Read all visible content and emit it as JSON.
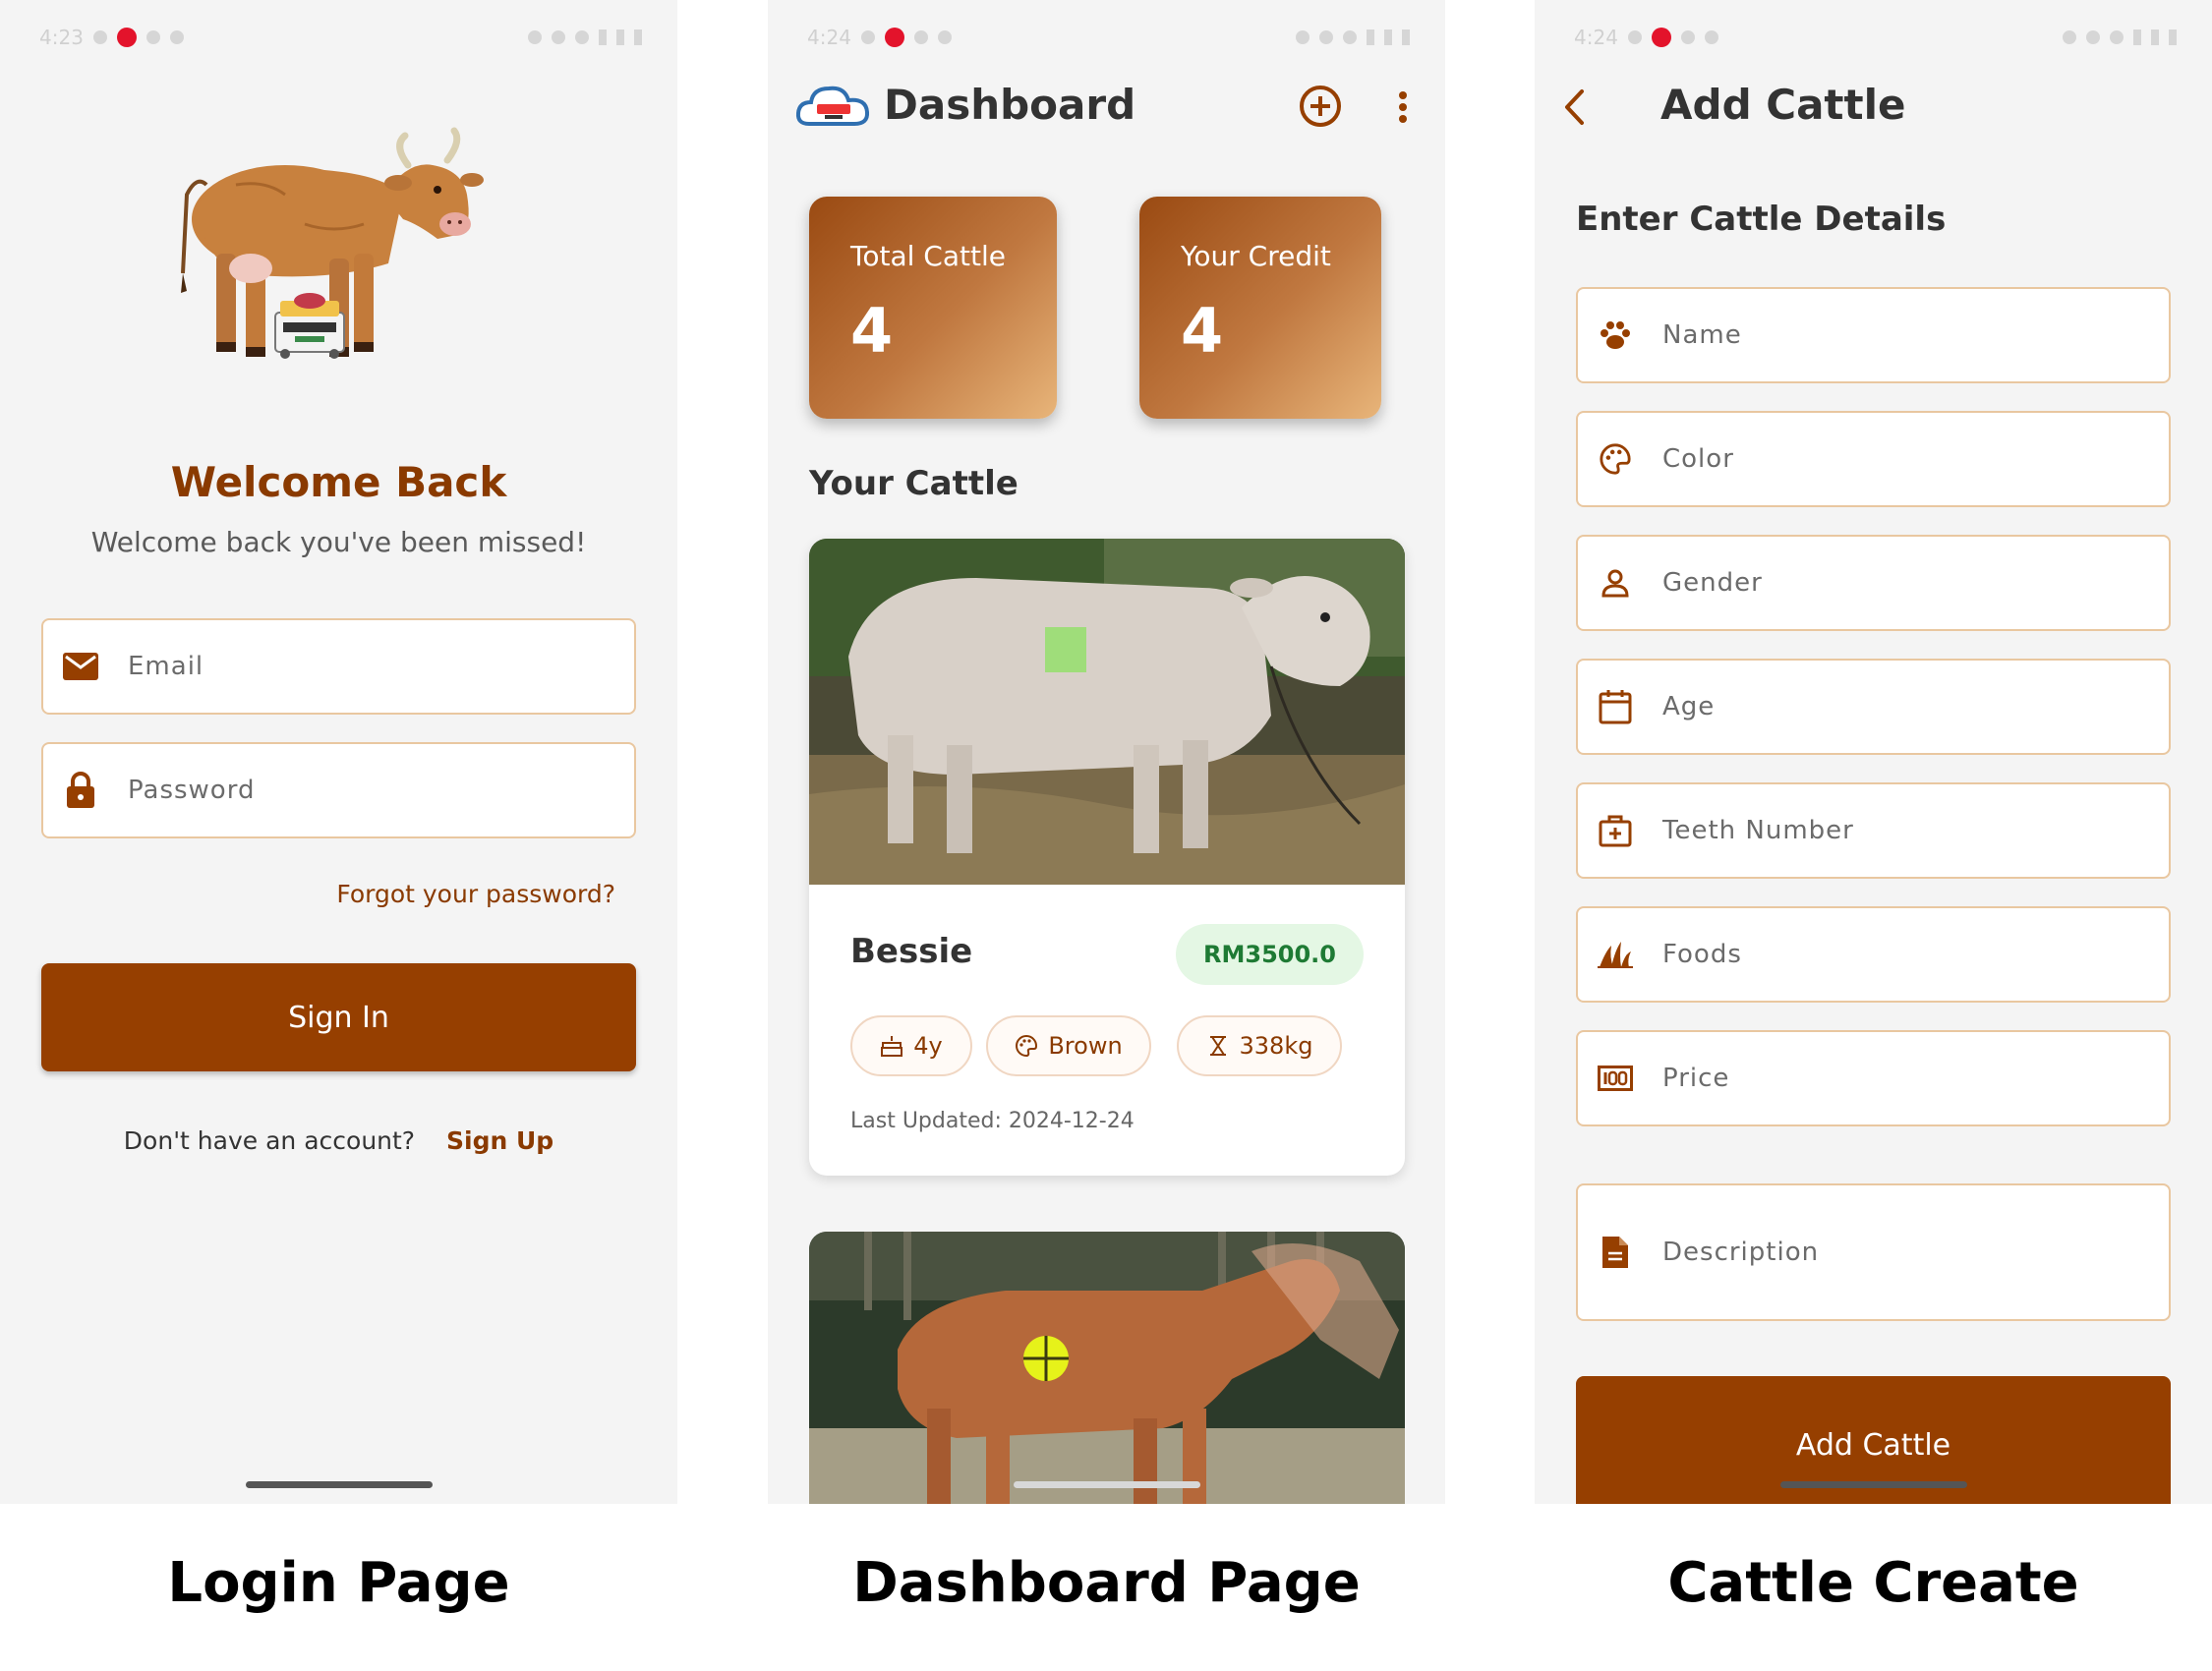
{
  "status_bars": {
    "login_time": "4:23",
    "dashboard_time": "4:24",
    "create_time": "4:24"
  },
  "login": {
    "title": "Welcome Back",
    "subtitle": "Welcome back you've been missed!",
    "email_placeholder": "Email",
    "password_placeholder": "Password",
    "forgot_link": "Forgot your password?",
    "signin_label": "Sign In",
    "no_account_text": "Don't have an account?",
    "signup_link": "Sign Up",
    "icons": [
      "cow-illustration",
      "mail-icon",
      "lock-icon"
    ]
  },
  "dashboard": {
    "title": "Dashboard",
    "stats": [
      {
        "label": "Total Cattle",
        "value": "4"
      },
      {
        "label": "Your Credit",
        "value": "4"
      }
    ],
    "section_title": "Your Cattle",
    "cattle": [
      {
        "name": "Bessie",
        "price": "RM3500.0",
        "age": "4y",
        "color": "Brown",
        "weight": "338kg",
        "last_updated": "Last Updated: 2024-12-24"
      }
    ],
    "icons": [
      "cloud-logo-icon",
      "add-circle-icon",
      "more-vert-icon",
      "cake-icon",
      "palette-icon",
      "scale-icon"
    ]
  },
  "create": {
    "title": "Add Cattle",
    "section_title": "Enter Cattle Details",
    "fields": [
      {
        "label": "Name",
        "icon": "paw-icon"
      },
      {
        "label": "Color",
        "icon": "palette-icon"
      },
      {
        "label": "Gender",
        "icon": "person-icon"
      },
      {
        "label": "Age",
        "icon": "calendar-icon"
      },
      {
        "label": "Teeth Number",
        "icon": "medical-bag-icon"
      },
      {
        "label": "Foods",
        "icon": "grass-icon"
      },
      {
        "label": "Price",
        "icon": "money-icon"
      },
      {
        "label": "Description",
        "icon": "document-icon"
      }
    ],
    "submit_label": "Add Cattle"
  },
  "captions": {
    "login": "Login Page",
    "dashboard": "Dashboard Page",
    "create": "Cattle Create"
  },
  "colors": {
    "accent": "#963f00",
    "field_border": "#e9c7a0",
    "background": "#f4f4f4",
    "price_badge_bg": "#e4f7e4",
    "price_badge_text": "#1e7a34"
  }
}
